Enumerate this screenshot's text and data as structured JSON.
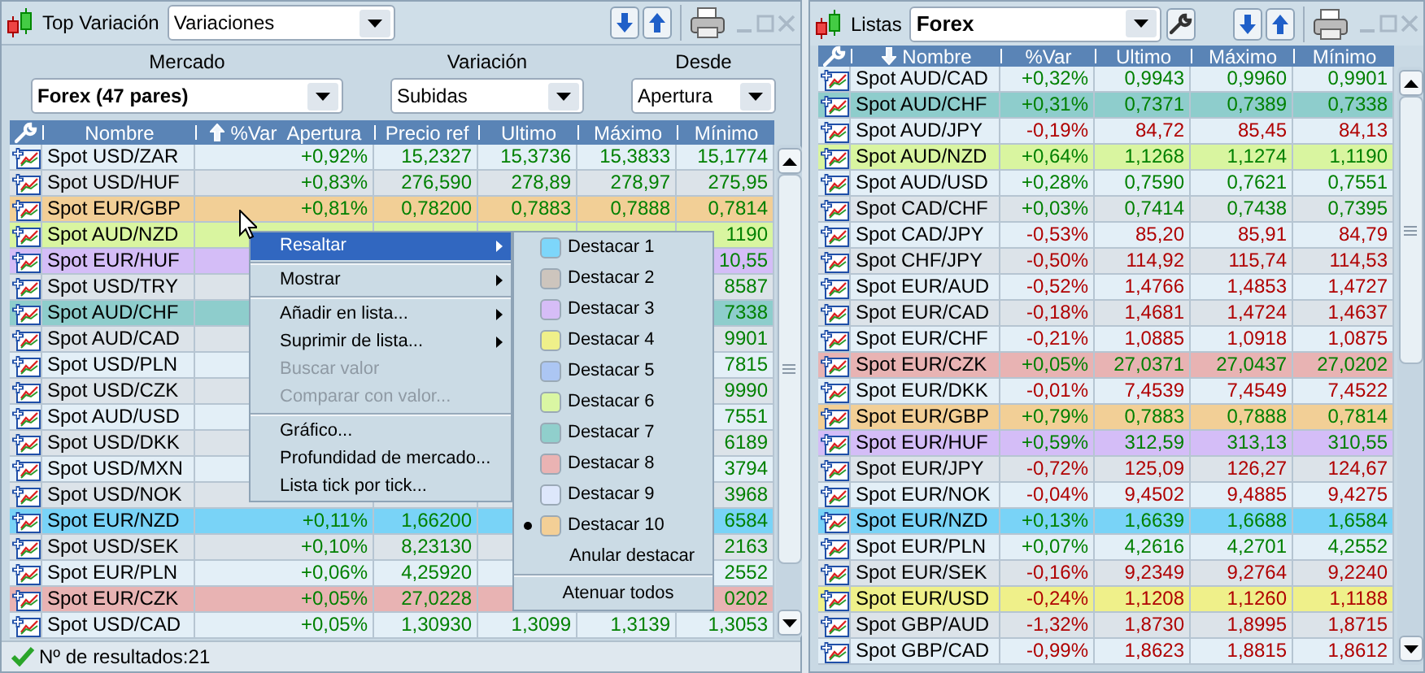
{
  "left_panel": {
    "title": "Top Variación",
    "view_select": "Variaciones",
    "filters": [
      {
        "label": "Mercado",
        "value": "Forex (47 pares)"
      },
      {
        "label": "Variación",
        "value": "Subidas"
      },
      {
        "label": "Desde",
        "value": "Apertura"
      }
    ],
    "table": {
      "columns": [
        {
          "label": "Nombre"
        },
        {
          "label": "%Var  Apertura",
          "sort_up": true
        },
        {
          "label": "Precio ref"
        },
        {
          "label": "Ultimo"
        },
        {
          "label": "Máximo"
        },
        {
          "label": "Mínimo"
        }
      ],
      "rows": [
        {
          "name": "Spot USD/ZAR",
          "var": "+0,92%",
          "ref": "15,2327",
          "last": "15,3736",
          "high": "15,3833",
          "low": "15,1774",
          "negative": false
        },
        {
          "name": "Spot USD/HUF",
          "var": "+0,83%",
          "ref": "276,590",
          "last": "278,89",
          "high": "278,97",
          "low": "275,95",
          "negative": false
        },
        {
          "name": "Spot EUR/GBP",
          "var": "+0,81%",
          "ref": "0,78200",
          "last": "0,7883",
          "high": "0,7888",
          "low": "0,7814",
          "negative": false,
          "color": "#f2cf96"
        },
        {
          "name": "Spot AUD/NZD",
          "low": "1190",
          "negative": false,
          "color": "#d9f5a0"
        },
        {
          "name": "Spot EUR/HUF",
          "low": "10,55",
          "negative": false,
          "color": "#d4bdf7"
        },
        {
          "name": "Spot USD/TRY",
          "low": "8587",
          "negative": false
        },
        {
          "name": "Spot AUD/CHF",
          "low": "7338",
          "negative": false,
          "color": "#8ecdcc"
        },
        {
          "name": "Spot AUD/CAD",
          "low": "9901",
          "negative": false
        },
        {
          "name": "Spot USD/PLN",
          "low": "7815",
          "negative": false
        },
        {
          "name": "Spot USD/CZK",
          "low": "9990",
          "negative": false
        },
        {
          "name": "Spot AUD/USD",
          "low": "7551",
          "negative": false
        },
        {
          "name": "Spot USD/DKK",
          "low": "6189",
          "negative": false
        },
        {
          "name": "Spot USD/MXN",
          "low": "3794",
          "negative": false
        },
        {
          "name": "Spot USD/NOK",
          "low": "3968",
          "negative": false
        },
        {
          "name": "Spot EUR/NZD",
          "var": "+0,11%",
          "ref": "1,66200",
          "low": "6584",
          "negative": false,
          "color": "#79d3f7"
        },
        {
          "name": "Spot USD/SEK",
          "var": "+0,10%",
          "ref": "8,23130",
          "low": "2163",
          "negative": false
        },
        {
          "name": "Spot EUR/PLN",
          "var": "+0,06%",
          "ref": "4,25920",
          "low": "2552",
          "negative": false
        },
        {
          "name": "Spot EUR/CZK",
          "var": "+0,05%",
          "ref": "27,0228",
          "low": "0202",
          "negative": false,
          "color": "#e8b3b3"
        },
        {
          "name": "Spot USD/CAD",
          "var": "+0,05%",
          "ref": "1,30930",
          "last": "1,3099",
          "high": "1,3139",
          "low": "1,3053",
          "negative": false
        }
      ]
    },
    "status": "Nº de resultados:21"
  },
  "context_menu": {
    "groups": [
      [
        {
          "label": "Resaltar",
          "submenu": true,
          "disabled": false,
          "selected": true
        }
      ],
      [
        {
          "label": "Mostrar",
          "submenu": true,
          "disabled": false,
          "selected": false
        }
      ],
      [
        {
          "label": "Añadir en lista...",
          "submenu": true,
          "disabled": false,
          "selected": false
        },
        {
          "label": "Suprimir de lista...",
          "submenu": true,
          "disabled": false,
          "selected": false
        },
        {
          "label": "Buscar valor",
          "submenu": false,
          "disabled": true,
          "selected": false
        },
        {
          "label": "Comparar con valor...",
          "submenu": false,
          "disabled": true,
          "selected": false
        }
      ],
      [
        {
          "label": "Gráfico...",
          "submenu": false,
          "disabled": false,
          "selected": false
        },
        {
          "label": "Profundidad de mercado...",
          "submenu": false,
          "disabled": false,
          "selected": false
        },
        {
          "label": "Lista tick por tick...",
          "submenu": false,
          "disabled": false,
          "selected": false
        }
      ]
    ],
    "submenu": [
      [
        {
          "label": "Destacar 1",
          "color": "#7dd6fa",
          "selected": false
        },
        {
          "label": "Destacar 2",
          "color": "#cdc5bd",
          "selected": false
        },
        {
          "label": "Destacar 3",
          "color": "#d6bdf7",
          "selected": false
        },
        {
          "label": "Destacar 4",
          "color": "#eff08a",
          "selected": false
        },
        {
          "label": "Destacar 5",
          "color": "#acc6f3",
          "selected": false
        },
        {
          "label": "Destacar 6",
          "color": "#daf6a3",
          "selected": false
        },
        {
          "label": "Destacar 7",
          "color": "#90cfcc",
          "selected": false
        },
        {
          "label": "Destacar 8",
          "color": "#eab3b3",
          "selected": false
        },
        {
          "label": "Destacar 9",
          "color": "#dde7fb",
          "selected": false
        },
        {
          "label": "Destacar 10",
          "color": "#f3cf96",
          "selected": true
        },
        {
          "label": "Anular destacar",
          "selected": false
        }
      ],
      [
        {
          "label": "Atenuar todos",
          "selected": false
        }
      ]
    ]
  },
  "right_panel": {
    "title": "Listas",
    "list_select": "Forex",
    "table": {
      "columns": [
        {
          "label": "Nombre",
          "sort_up": false
        },
        {
          "label": "%Var"
        },
        {
          "label": "Ultimo"
        },
        {
          "label": "Máximo"
        },
        {
          "label": "Mínimo"
        }
      ],
      "rows": [
        {
          "name": "Spot AUD/CAD",
          "var": "+0,32%",
          "last": "0,9943",
          "high": "0,9960",
          "low": "0,9901",
          "negative": false
        },
        {
          "name": "Spot AUD/CHF",
          "var": "+0,31%",
          "last": "0,7371",
          "high": "0,7389",
          "low": "0,7338",
          "negative": false,
          "color": "#8ecdcc"
        },
        {
          "name": "Spot AUD/JPY",
          "var": "-0,19%",
          "last": "84,72",
          "high": "85,45",
          "low": "84,13",
          "negative": true
        },
        {
          "name": "Spot AUD/NZD",
          "var": "+0,64%",
          "last": "1,1268",
          "high": "1,1274",
          "low": "1,1190",
          "negative": false,
          "color": "#d9f5a0"
        },
        {
          "name": "Spot AUD/USD",
          "var": "+0,28%",
          "last": "0,7590",
          "high": "0,7621",
          "low": "0,7551",
          "negative": false
        },
        {
          "name": "Spot CAD/CHF",
          "var": "+0,03%",
          "last": "0,7414",
          "high": "0,7438",
          "low": "0,7395",
          "negative": false
        },
        {
          "name": "Spot CAD/JPY",
          "var": "-0,53%",
          "last": "85,20",
          "high": "85,91",
          "low": "84,79",
          "negative": true
        },
        {
          "name": "Spot CHF/JPY",
          "var": "-0,50%",
          "last": "114,92",
          "high": "115,74",
          "low": "114,53",
          "negative": true
        },
        {
          "name": "Spot EUR/AUD",
          "var": "-0,52%",
          "last": "1,4766",
          "high": "1,4853",
          "low": "1,4727",
          "negative": true
        },
        {
          "name": "Spot EUR/CAD",
          "var": "-0,18%",
          "last": "1,4681",
          "high": "1,4724",
          "low": "1,4637",
          "negative": true
        },
        {
          "name": "Spot EUR/CHF",
          "var": "-0,21%",
          "last": "1,0885",
          "high": "1,0918",
          "low": "1,0875",
          "negative": true
        },
        {
          "name": "Spot EUR/CZK",
          "var": "+0,05%",
          "last": "27,0371",
          "high": "27,0437",
          "low": "27,0202",
          "negative": false,
          "color": "#e8b3b3"
        },
        {
          "name": "Spot EUR/DKK",
          "var": "-0,01%",
          "last": "7,4539",
          "high": "7,4549",
          "low": "7,4522",
          "negative": true
        },
        {
          "name": "Spot EUR/GBP",
          "var": "+0,79%",
          "last": "0,7883",
          "high": "0,7888",
          "low": "0,7814",
          "negative": false,
          "color": "#f2cf96"
        },
        {
          "name": "Spot EUR/HUF",
          "var": "+0,59%",
          "last": "312,59",
          "high": "313,13",
          "low": "310,55",
          "negative": false,
          "color": "#d4bdf7"
        },
        {
          "name": "Spot EUR/JPY",
          "var": "-0,72%",
          "last": "125,09",
          "high": "126,27",
          "low": "124,67",
          "negative": true
        },
        {
          "name": "Spot EUR/NOK",
          "var": "-0,04%",
          "last": "9,4502",
          "high": "9,4885",
          "low": "9,4275",
          "negative": true
        },
        {
          "name": "Spot EUR/NZD",
          "var": "+0,13%",
          "last": "1,6639",
          "high": "1,6688",
          "low": "1,6584",
          "negative": false,
          "color": "#79d3f7"
        },
        {
          "name": "Spot EUR/PLN",
          "var": "+0,07%",
          "last": "4,2616",
          "high": "4,2701",
          "low": "4,2552",
          "negative": false
        },
        {
          "name": "Spot EUR/SEK",
          "var": "-0,16%",
          "last": "9,2349",
          "high": "9,2764",
          "low": "9,2240",
          "negative": true
        },
        {
          "name": "Spot EUR/USD",
          "var": "-0,24%",
          "last": "1,1208",
          "high": "1,1260",
          "low": "1,1188",
          "negative": true,
          "color": "#eff08a"
        },
        {
          "name": "Spot GBP/AUD",
          "var": "-1,32%",
          "last": "1,8730",
          "high": "1,8995",
          "low": "1,8715",
          "negative": true
        },
        {
          "name": "Spot GBP/CAD",
          "var": "-0,99%",
          "last": "1,8623",
          "high": "1,8815",
          "low": "1,8612",
          "negative": true
        }
      ]
    }
  }
}
